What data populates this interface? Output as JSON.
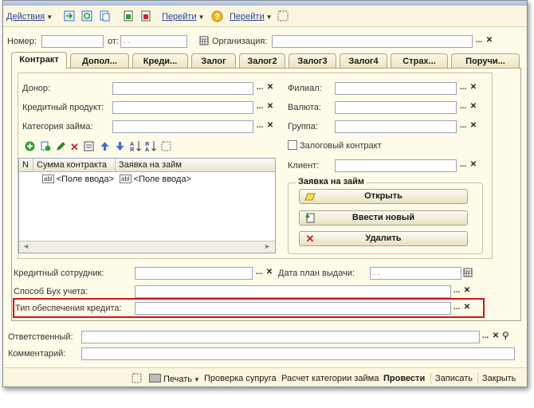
{
  "toolbar": {
    "actions": "Действия",
    "goto1": "Перейти",
    "goto2": "Перейти",
    "help": "?"
  },
  "header": {
    "number_label": "Номер:",
    "number_value": "",
    "from_label": "от:",
    "date_value": ". .",
    "org_label": "Организация:",
    "org_value": ""
  },
  "tabs": [
    {
      "label": "Контракт"
    },
    {
      "label": "Допол..."
    },
    {
      "label": "Креди..."
    },
    {
      "label": "Залог"
    },
    {
      "label": "Залог2"
    },
    {
      "label": "Залог3"
    },
    {
      "label": "Залог4"
    },
    {
      "label": "Страх..."
    },
    {
      "label": "Поручи..."
    }
  ],
  "left_fields": {
    "donor": "Донор:",
    "credit_product": "Кредитный продукт:",
    "loan_category": "Категория займа:"
  },
  "right_fields": {
    "branch": "Филиал:",
    "currency": "Валюта:",
    "group": "Группа:",
    "pledge_contract": "Залоговый контракт",
    "client": "Клиент:"
  },
  "grid": {
    "columns": [
      "N",
      "Сумма контракта",
      "Заявка на займ"
    ],
    "row": {
      "amount": "<Поле ввода>",
      "application": "<Поле ввода>"
    },
    "abl": "abl"
  },
  "application_group": {
    "title": "Заявка на займ",
    "open": "Открыть",
    "new": "Ввести новый",
    "delete": "Удалить"
  },
  "bottom_fields": {
    "credit_officer": "Кредитный сотрудник:",
    "plan_date": "Дата план выдачи:",
    "plan_date_value": ". .",
    "accounting_method": "Способ Бух учета:",
    "collateral_type": "Тип обеспечения кредита:"
  },
  "outer_fields": {
    "responsible": "Ответственный:",
    "comment": "Комментарий:"
  },
  "footer": {
    "print": "Печать",
    "check_spouse": "Проверка супруга",
    "calc_category": "Расчет категории займа",
    "post": "Провести",
    "save": "Записать",
    "close": "Закрыть"
  },
  "colors": {
    "background": "#fffbe9",
    "link": "#2a3f9a",
    "highlight_border": "#d0141c",
    "icon_green": "#2e9a2e",
    "icon_red": "#d02020",
    "icon_blue": "#3a6fd0"
  }
}
